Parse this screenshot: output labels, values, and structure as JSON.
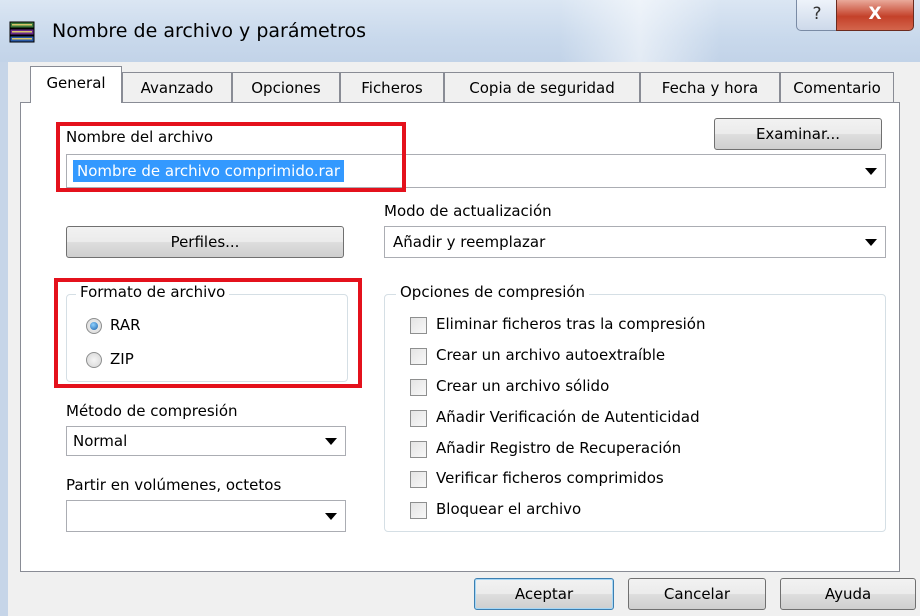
{
  "window": {
    "title": "Nombre de archivo y parámetros",
    "help_symbol": "?",
    "close_symbol": "X"
  },
  "tabs": [
    {
      "label": "General",
      "active": true
    },
    {
      "label": "Avanzado",
      "active": false
    },
    {
      "label": "Opciones",
      "active": false
    },
    {
      "label": "Ficheros",
      "active": false
    },
    {
      "label": "Copia de seguridad",
      "active": false
    },
    {
      "label": "Fecha y hora",
      "active": false
    },
    {
      "label": "Comentario",
      "active": false
    }
  ],
  "general": {
    "filename_label": "Nombre del archivo",
    "filename_value": "Nombre de archivo comprimido.rar",
    "browse_button": "Examinar...",
    "update_mode_label": "Modo de actualización",
    "update_mode_value": "Añadir y reemplazar",
    "profiles_button": "Perfiles...",
    "format_group_title": "Formato de archivo",
    "format_options": [
      {
        "label": "RAR",
        "checked": true
      },
      {
        "label": "ZIP",
        "checked": false
      }
    ],
    "compression_method_label": "Método de compresión",
    "compression_method_value": "Normal",
    "split_label": "Partir en volúmenes, octetos",
    "split_value": "",
    "compression_options_title": "Opciones de compresión",
    "compression_options": [
      {
        "label": "Eliminar ficheros tras la compresión",
        "checked": false
      },
      {
        "label": "Crear un archivo autoextraíble",
        "checked": false
      },
      {
        "label": "Crear un archivo sólido",
        "checked": false
      },
      {
        "label": "Añadir Verificación de Autenticidad",
        "checked": false
      },
      {
        "label": "Añadir Registro de Recuperación",
        "checked": false
      },
      {
        "label": "Verificar ficheros comprimidos",
        "checked": false
      },
      {
        "label": "Bloquear el archivo",
        "checked": false
      }
    ]
  },
  "footer": {
    "ok_button": "Aceptar",
    "cancel_button": "Cancelar",
    "help_button": "Ayuda"
  },
  "colors": {
    "highlight_box": "#e4111c",
    "selection": "#3399ff"
  },
  "icons": {
    "app": "winrar-books-icon",
    "dropdown": "chevron-down-icon"
  }
}
